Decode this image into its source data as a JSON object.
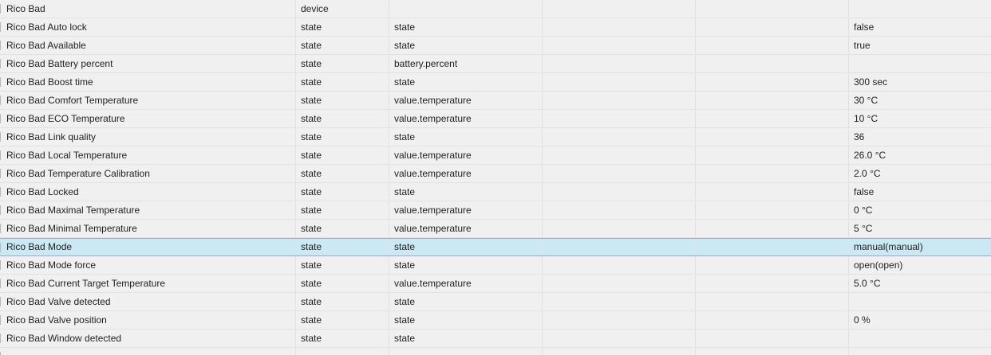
{
  "table": {
    "rows": [
      {
        "name": "Rico Bad",
        "type": "device",
        "role": "",
        "c3": "",
        "c4": "",
        "value": ""
      },
      {
        "name": "Rico Bad Auto lock",
        "type": "state",
        "role": "state",
        "c3": "",
        "c4": "",
        "value": "false"
      },
      {
        "name": "Rico Bad Available",
        "type": "state",
        "role": "state",
        "c3": "",
        "c4": "",
        "value": "true"
      },
      {
        "name": "Rico Bad Battery percent",
        "type": "state",
        "role": "battery.percent",
        "c3": "",
        "c4": "",
        "value": ""
      },
      {
        "name": "Rico Bad Boost time",
        "type": "state",
        "role": "state",
        "c3": "",
        "c4": "",
        "value": "300 sec"
      },
      {
        "name": "Rico Bad Comfort Temperature",
        "type": "state",
        "role": "value.temperature",
        "c3": "",
        "c4": "",
        "value": "30 °C"
      },
      {
        "name": "Rico Bad ECO Temperature",
        "type": "state",
        "role": "value.temperature",
        "c3": "",
        "c4": "",
        "value": "10 °C"
      },
      {
        "name": "Rico Bad Link quality",
        "type": "state",
        "role": "state",
        "c3": "",
        "c4": "",
        "value": "36"
      },
      {
        "name": "Rico Bad Local Temperature",
        "type": "state",
        "role": "value.temperature",
        "c3": "",
        "c4": "",
        "value": "26.0 °C"
      },
      {
        "name": "Rico Bad Temperature Calibration",
        "type": "state",
        "role": "value.temperature",
        "c3": "",
        "c4": "",
        "value": "2.0 °C"
      },
      {
        "name": "Rico Bad Locked",
        "type": "state",
        "role": "state",
        "c3": "",
        "c4": "",
        "value": "false"
      },
      {
        "name": "Rico Bad Maximal Temperature",
        "type": "state",
        "role": "value.temperature",
        "c3": "",
        "c4": "",
        "value": "0 °C"
      },
      {
        "name": "Rico Bad Minimal Temperature",
        "type": "state",
        "role": "value.temperature",
        "c3": "",
        "c4": "",
        "value": "5 °C"
      },
      {
        "name": "Rico Bad Mode",
        "type": "state",
        "role": "state",
        "c3": "",
        "c4": "",
        "value": "manual(manual)",
        "selected": true
      },
      {
        "name": "Rico Bad Mode force",
        "type": "state",
        "role": "state",
        "c3": "",
        "c4": "",
        "value": "open(open)"
      },
      {
        "name": "Rico Bad Current Target Temperature",
        "type": "state",
        "role": "value.temperature",
        "c3": "",
        "c4": "",
        "value": "5.0 °C"
      },
      {
        "name": "Rico Bad Valve detected",
        "type": "state",
        "role": "state",
        "c3": "",
        "c4": "",
        "value": ""
      },
      {
        "name": "Rico Bad Valve position",
        "type": "state",
        "role": "state",
        "c3": "",
        "c4": "",
        "value": "0 %"
      },
      {
        "name": "Rico Bad Window detected",
        "type": "state",
        "role": "state",
        "c3": "",
        "c4": "",
        "value": ""
      },
      {
        "name": "",
        "type": "",
        "role": "",
        "c3": "",
        "c4": "",
        "value": ""
      }
    ]
  }
}
